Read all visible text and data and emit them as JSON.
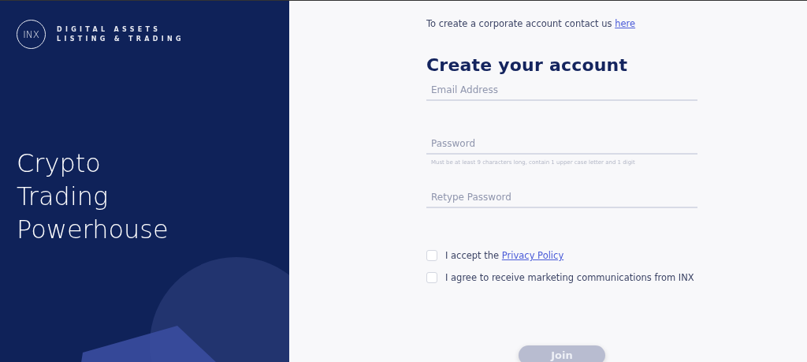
{
  "brand": {
    "logo": "INX",
    "tagline_lines": [
      "DIGITAL ASSETS",
      "LISTING & TRADING"
    ]
  },
  "hero": {
    "lines": [
      "Crypto",
      "Trading",
      "Powerhouse"
    ]
  },
  "corporate_note": {
    "text": "To create a corporate account contact us",
    "link": "here"
  },
  "heading": "Create your account",
  "fields": [
    {
      "placeholder": "Email Address"
    },
    {
      "placeholder": "Password",
      "hint": "Must be at least 9 characters long, contain 1 upper case letter and 1 digit"
    },
    {
      "placeholder": "Retype Password"
    }
  ],
  "checkboxes": [
    {
      "text": "I accept the",
      "link": "Privacy Policy",
      "checked": false
    },
    {
      "text": "I agree to receive marketing communications from INX",
      "checked": false
    }
  ],
  "join_button": {
    "label": "Join",
    "disabled": true
  }
}
